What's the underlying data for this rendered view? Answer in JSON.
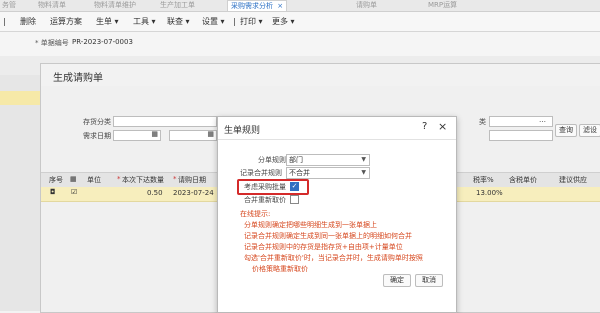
{
  "tabs": [
    "务管",
    "物料清单",
    "物料清单维护",
    "生产加工单",
    "采购需求分析",
    "请购单",
    "MRP运算"
  ],
  "active_tab": "采购需求分析",
  "tab_close_glyph": "×",
  "toolbar": {
    "delete": "删除",
    "calc_plan": "运算方案",
    "generate": "生单",
    "tools": "工具",
    "lookup": "联查",
    "settings": "设置",
    "print": "打印",
    "more": "更多"
  },
  "doc": {
    "label": "单据编号",
    "value": "PR-2023-07-0003"
  },
  "dialog1": {
    "title": "生成请购单",
    "fields": {
      "category": "存货分类",
      "req_date": "需求日期",
      "partial_right": "类"
    },
    "buttons": {
      "query": "查询",
      "filter": "滤设"
    },
    "columns": [
      "序号",
      "单位",
      "本次下达数量",
      "请购日期",
      "税率%",
      "含税单价",
      "建议供应"
    ],
    "row": {
      "qty": "0.50",
      "date": "2023-07-24",
      "tax": "13.00%"
    }
  },
  "dialog2": {
    "title": "生单规则",
    "fields": [
      {
        "label": "分单规则",
        "value": "部门"
      },
      {
        "label": "记录合并规则",
        "value": "不合并"
      }
    ],
    "chk1": {
      "label": "考虑采购批量",
      "checked": true
    },
    "chk2": {
      "label": "合并重新取价",
      "checked": false
    },
    "notes": [
      "在线提示:",
      "分单规则确定把哪些明细生成到一张单据上",
      "记录合并规则确定生成到同一张单据上的明细如何合并",
      "记录合并规则中的存货是指存货+自由项+计量单位",
      "勾选'合并重新取价'时，当记录合并时，生成请购单时按照",
      "价格策略重新取价"
    ],
    "ok": "确定",
    "cancel": "取消"
  }
}
